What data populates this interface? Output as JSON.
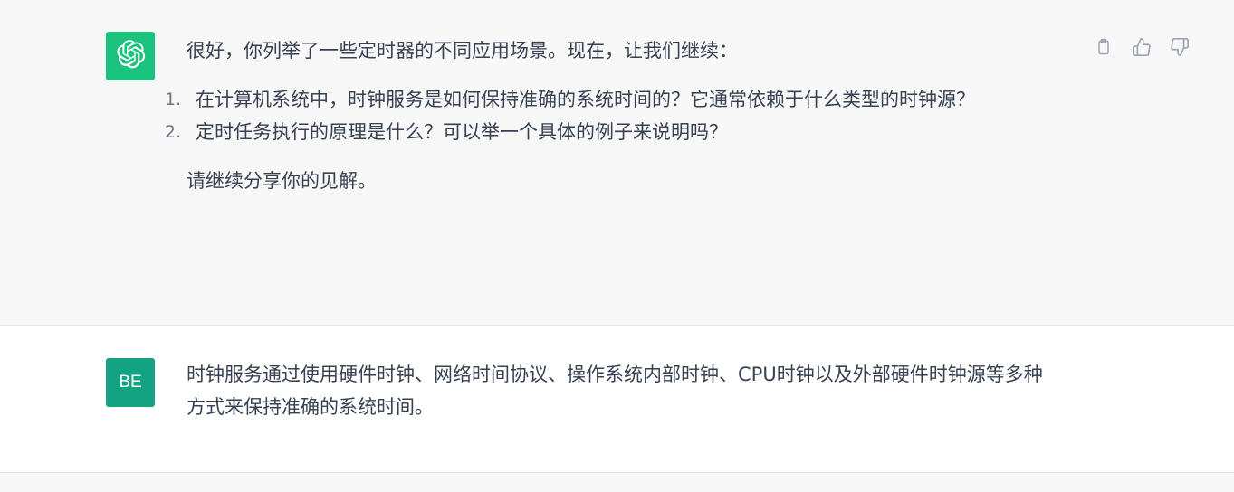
{
  "conversation": {
    "assistant_message": {
      "avatar_icon": "openai-logo-icon",
      "avatar_color": "#19c37d",
      "intro": "很好，你列举了一些定时器的不同应用场景。现在，让我们继续：",
      "items": [
        {
          "number": "1.",
          "text": "在计算机系统中，时钟服务是如何保持准确的系统时间的？它通常依赖于什么类型的时钟源？"
        },
        {
          "number": "2.",
          "text": "定时任务执行的原理是什么？可以举一个具体的例子来说明吗？"
        }
      ],
      "closing": "请继续分享你的见解。",
      "actions": [
        "copy-icon",
        "thumbs-up-icon",
        "thumbs-down-icon"
      ]
    },
    "user_message": {
      "avatar_text": "BE",
      "avatar_color": "#13a383",
      "text": "时钟服务通过使用硬件时钟、网络时间协议、操作系统内部时钟、CPU时钟以及外部硬件时钟源等多种方式来保持准确的系统时间。"
    }
  }
}
